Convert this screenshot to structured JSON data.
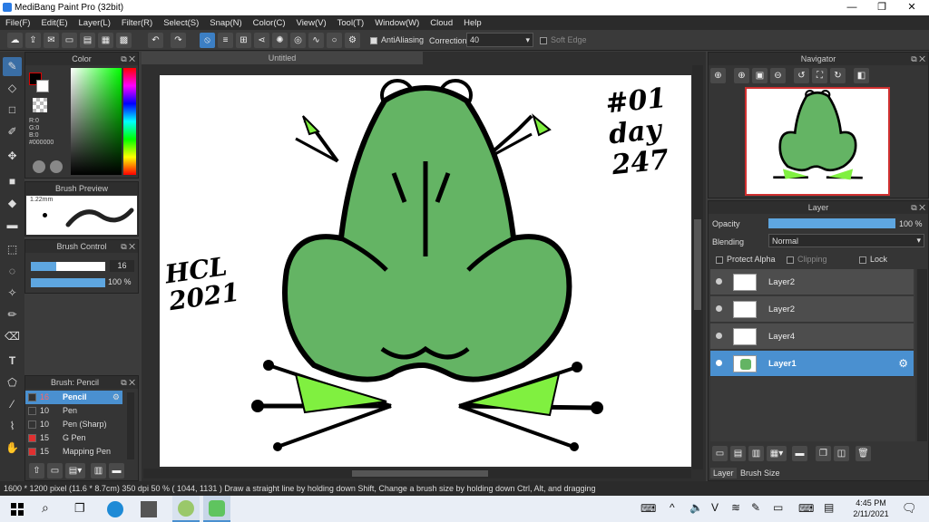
{
  "app": {
    "title": "MediBang Paint Pro (32bit)"
  },
  "menu": [
    "File(F)",
    "Edit(E)",
    "Layer(L)",
    "Filter(R)",
    "Select(S)",
    "Snap(N)",
    "Color(C)",
    "View(V)",
    "Tool(T)",
    "Window(W)",
    "Cloud",
    "Help"
  ],
  "toolbar": {
    "antialias_label": "AntiAliasing",
    "correction_label": "Correction",
    "correction_value": "40",
    "soft_edge_label": "Soft Edge"
  },
  "color_panel": {
    "title": "Color",
    "r": "R:0",
    "g": "G:0",
    "b": "B:0",
    "hex": "#000000"
  },
  "brush_preview": {
    "title": "Brush Preview",
    "size": "1.22mm"
  },
  "brush_control": {
    "title": "Brush Control",
    "size_value": "16",
    "opacity_value": "100 %"
  },
  "brush_list": {
    "title": "Brush: Pencil",
    "items": [
      {
        "size": "16",
        "name": "Pencil",
        "color": "#000000",
        "selected": true
      },
      {
        "size": "10",
        "name": "Pen",
        "color": "#000000",
        "selected": false
      },
      {
        "size": "10",
        "name": "Pen (Sharp)",
        "color": "#000000",
        "selected": false
      },
      {
        "size": "15",
        "name": "G Pen",
        "color": "#e03030",
        "selected": false
      },
      {
        "size": "15",
        "name": "Mapping Pen",
        "color": "#e03030",
        "selected": false
      }
    ]
  },
  "document": {
    "tab_title": "Untitled"
  },
  "canvas_text": {
    "left_line1": "HCL",
    "left_line2": "2021",
    "right_line1": "#01",
    "right_line2": "day",
    "right_line3": "247"
  },
  "navigator": {
    "title": "Navigator"
  },
  "layer_panel": {
    "title": "Layer",
    "opacity_label": "Opacity",
    "opacity_value": "100 %",
    "blending_label": "Blending",
    "blending_value": "Normal",
    "protect_alpha": "Protect Alpha",
    "clipping": "Clipping",
    "lock": "Lock",
    "layers": [
      {
        "name": "Layer2"
      },
      {
        "name": "Layer2"
      },
      {
        "name": "Layer4"
      },
      {
        "name": "Layer1"
      }
    ]
  },
  "bottom_tabs": [
    "Layer",
    "Brush Size"
  ],
  "status": {
    "text": "1600 * 1200 pixel   (11.6 * 8.7cm)   350 dpi   50 %   ( 1044, 1131 )   Draw a straight line by holding down Shift, Change a brush size by holding down Ctrl, Alt, and dragging"
  },
  "taskbar": {
    "time": "4:45 PM",
    "date": "2/11/2021"
  },
  "colors": {
    "frog_green": "#64b464",
    "accent_blue": "#4a90d0",
    "toe_green": "#80f040"
  },
  "icons": [
    "search-icon",
    "task-view-icon",
    "edge-icon",
    "store-icon",
    "medibang-icon",
    "paint-icon"
  ]
}
